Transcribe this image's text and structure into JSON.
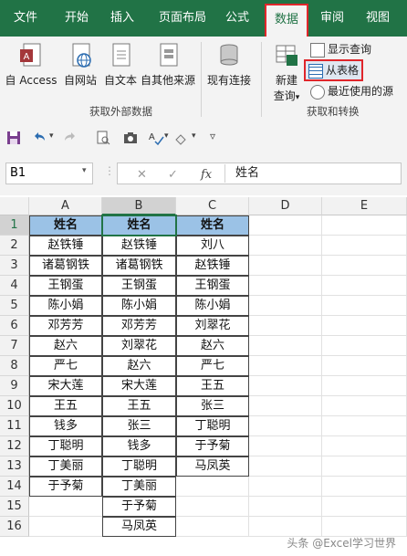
{
  "tabs": [
    "文件",
    "开始",
    "插入",
    "页面布局",
    "公式",
    "数据",
    "审阅",
    "视图"
  ],
  "active_tab": "数据",
  "ribbon": {
    "from_access": "自 Access",
    "from_web": "自网站",
    "from_text": "自文本",
    "from_other": "自其他来源",
    "existing_conn": "现有连接",
    "group1_label": "获取外部数据",
    "new_query": "新建",
    "new_query2": "查询",
    "show_queries": "显示查询",
    "from_table": "从表格",
    "recent_sources": "最近使用的源",
    "group2_label": "获取和转换"
  },
  "formula_bar": {
    "name_box": "B1",
    "fx": "fx",
    "value": "姓名"
  },
  "columns": [
    "A",
    "B",
    "C",
    "D",
    "E"
  ],
  "rows": [
    "1",
    "2",
    "3",
    "4",
    "5",
    "6",
    "7",
    "8",
    "9",
    "10",
    "11",
    "12",
    "13",
    "14",
    "15",
    "16"
  ],
  "col_a": [
    "姓名",
    "赵铁锤",
    "诸葛钢铁",
    "王钢蛋",
    "陈小娟",
    "邓芳芳",
    "赵六",
    "严七",
    "宋大莲",
    "王五",
    "钱多",
    "丁聪明",
    "丁美丽",
    "于予菊",
    "",
    ""
  ],
  "col_b": [
    "姓名",
    "赵铁锤",
    "诸葛钢铁",
    "王钢蛋",
    "陈小娟",
    "邓芳芳",
    "刘翠花",
    "赵六",
    "宋大莲",
    "王五",
    "张三",
    "钱多",
    "丁聪明",
    "丁美丽",
    "于予菊",
    "马凤英"
  ],
  "col_c": [
    "姓名",
    "刘八",
    "赵铁锤",
    "王钢蛋",
    "陈小娟",
    "刘翠花",
    "赵六",
    "严七",
    "王五",
    "张三",
    "丁聪明",
    "于予菊",
    "马凤英",
    "",
    "",
    ""
  ],
  "watermark": "头条 @Excel学习世界",
  "colors": {
    "excel_green": "#217346",
    "header_fill": "#9bc2e6",
    "highlight_red": "#e0262b"
  }
}
